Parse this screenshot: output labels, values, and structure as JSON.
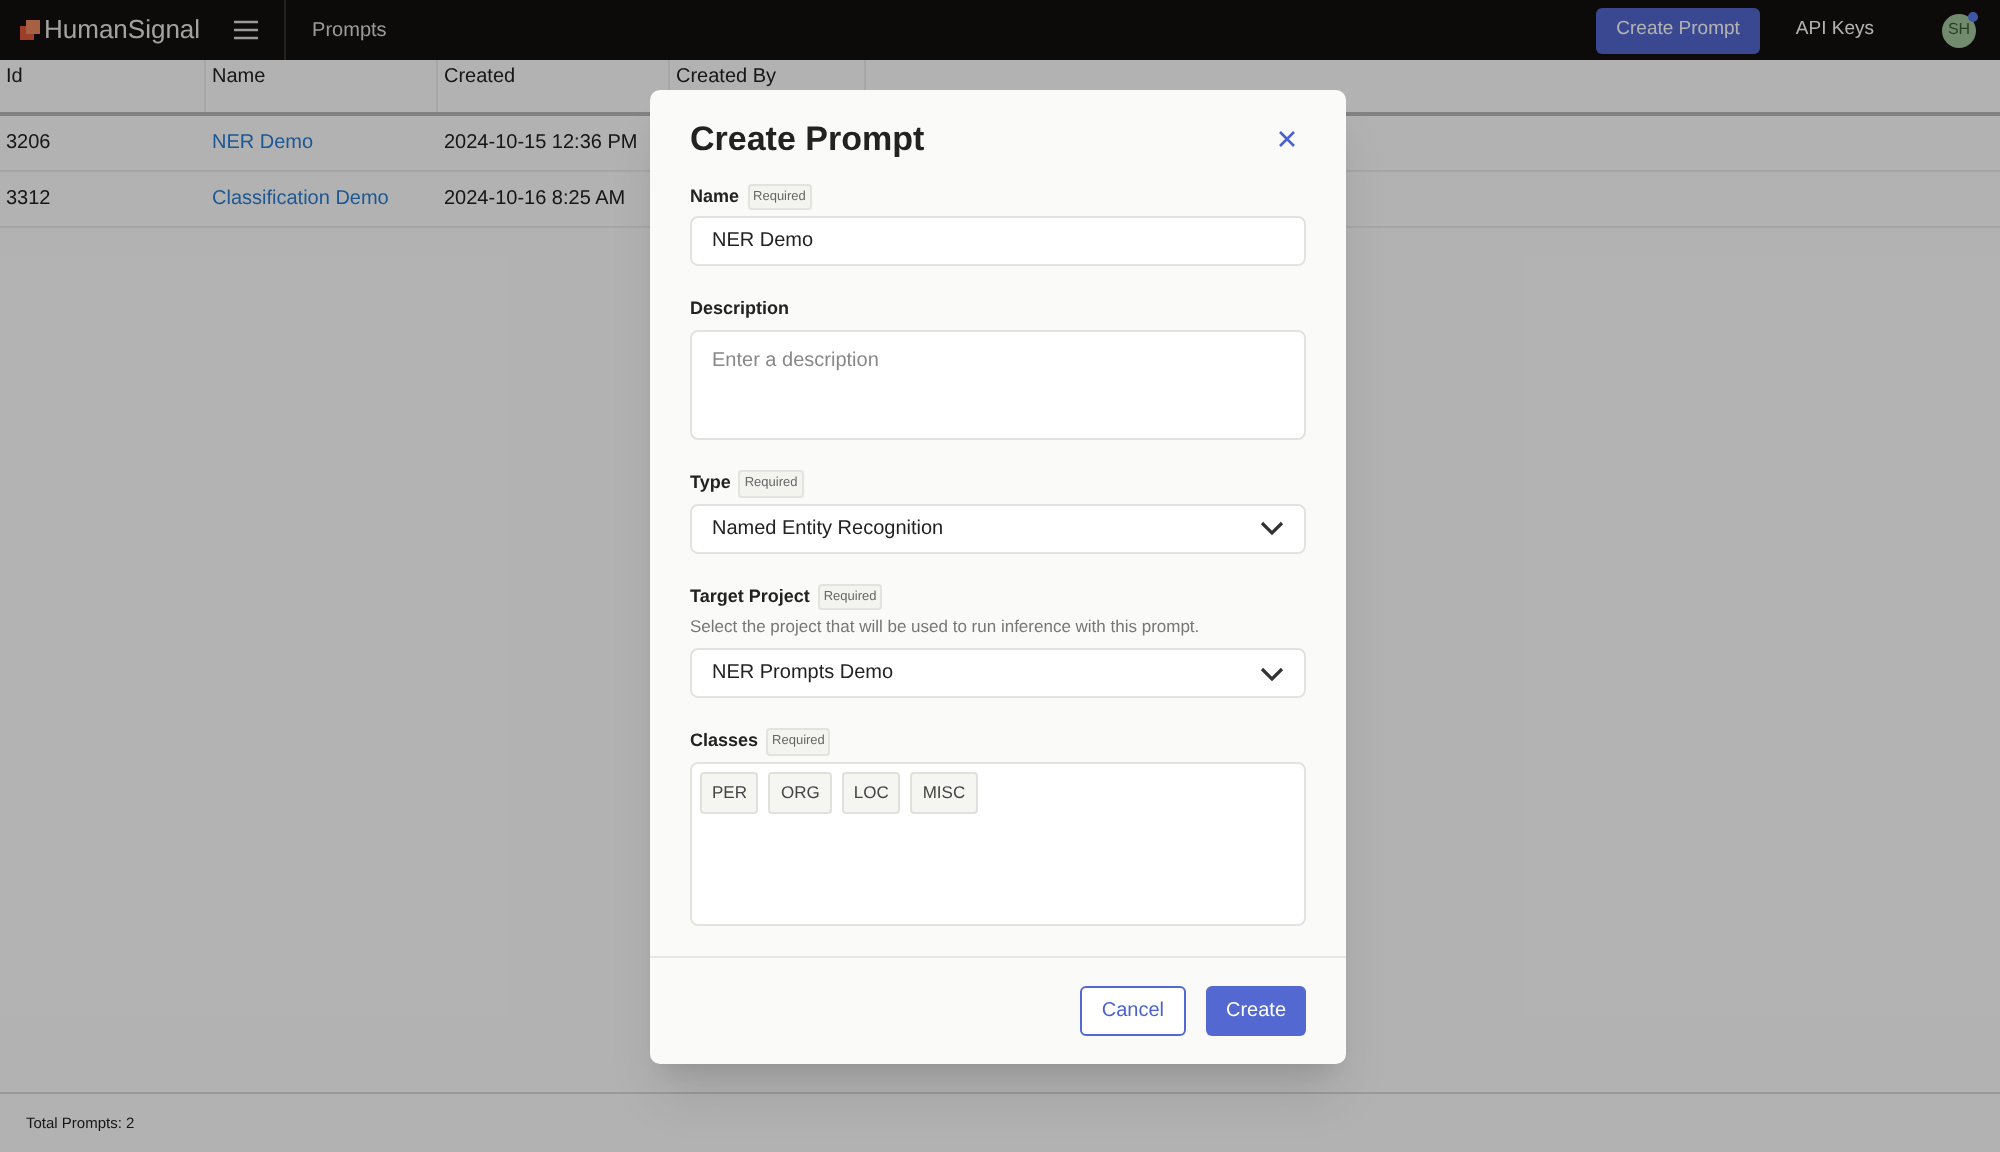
{
  "header": {
    "brand": "HumanSignal",
    "page_title": "Prompts",
    "create_button": "Create Prompt",
    "api_keys": "API Keys",
    "avatar": "SH"
  },
  "table": {
    "columns": [
      "Id",
      "Name",
      "Created",
      "Created By"
    ],
    "rows": [
      {
        "id": "3206",
        "name": "NER Demo",
        "created": "2024-10-15 12:36 PM"
      },
      {
        "id": "3312",
        "name": "Classification Demo",
        "created": "2024-10-16 8:25 AM"
      }
    ]
  },
  "status_bar": "Total Prompts: 2",
  "dialog": {
    "title": "Create Prompt",
    "fields": [
      {
        "kind": "text",
        "label": "Name",
        "required": "Required",
        "value": "NER Demo"
      },
      {
        "kind": "textarea",
        "label": "Description",
        "placeholder": "Enter a description"
      },
      {
        "kind": "select",
        "label": "Type",
        "required": "Required",
        "value": "Named Entity Recognition"
      },
      {
        "kind": "select",
        "label": "Target Project",
        "required": "Required",
        "help": "Select the project that will be used to run inference with this prompt.",
        "value": "NER Prompts Demo"
      },
      {
        "kind": "tags",
        "label": "Classes",
        "required": "Required",
        "tags": [
          "PER",
          "ORG",
          "LOC",
          "MISC"
        ]
      }
    ],
    "buttons": {
      "cancel": "Cancel",
      "create": "Create"
    }
  }
}
